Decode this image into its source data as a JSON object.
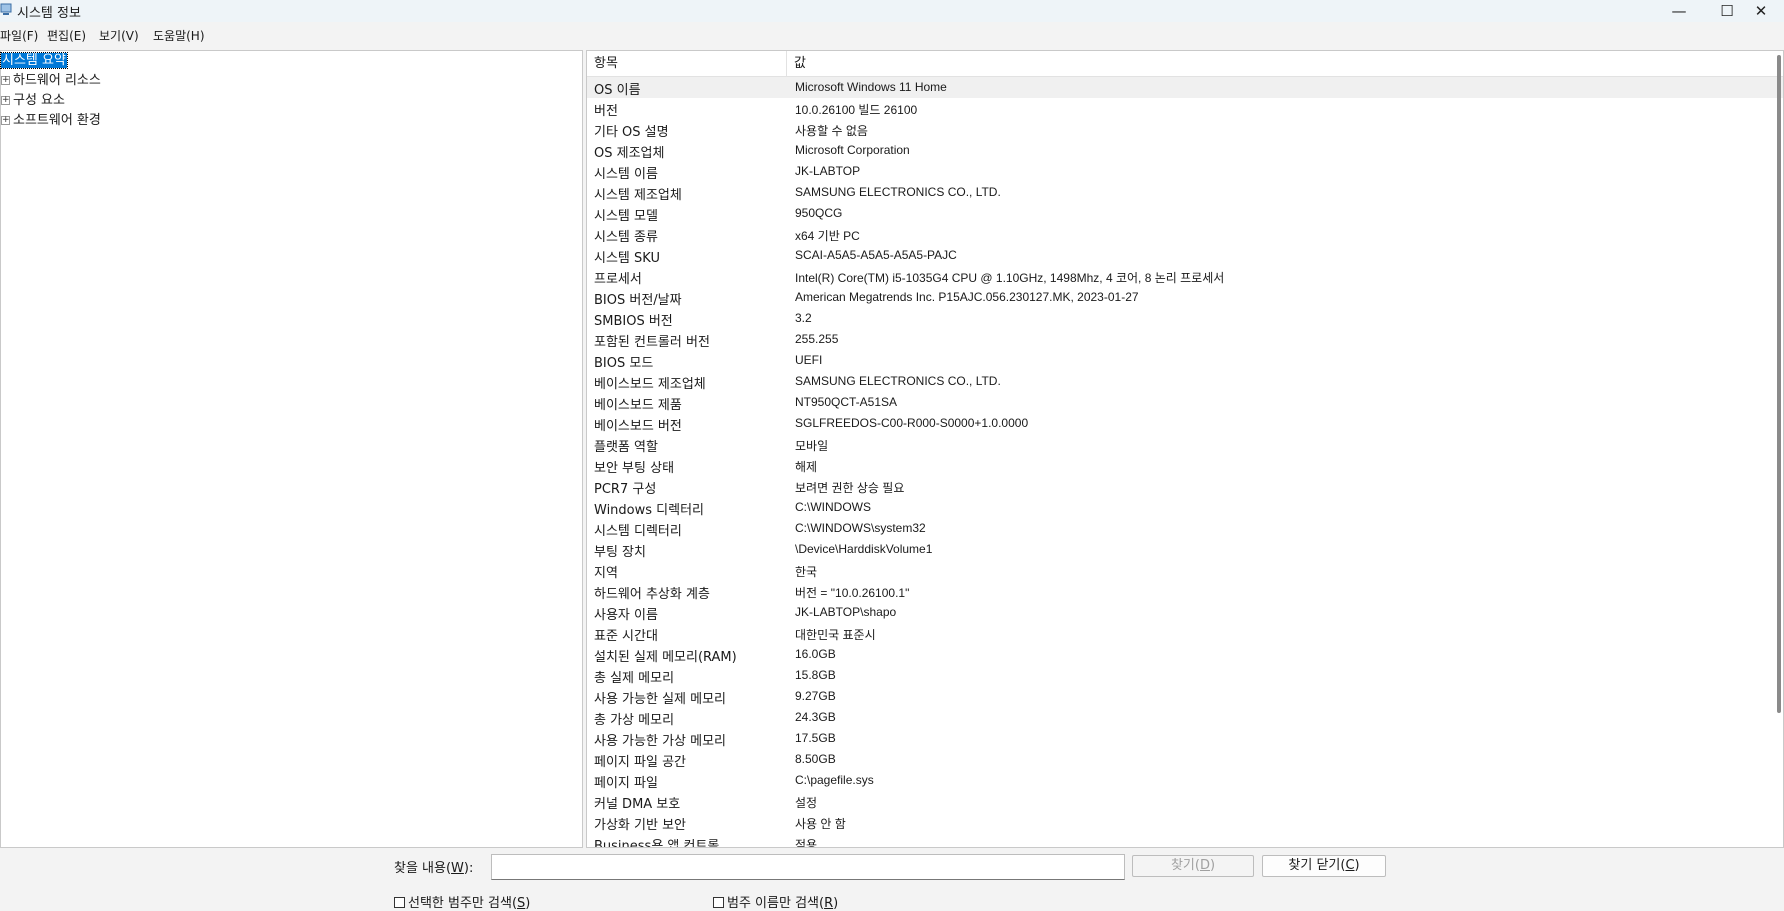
{
  "window": {
    "title": "시스템 정보",
    "controls": {
      "minimize": "—",
      "maximize": "☐",
      "close": "✕"
    }
  },
  "menu": {
    "items": [
      "파일(F)",
      "편집(E)",
      "보기(V)",
      "도움말(H)"
    ]
  },
  "tree": {
    "items": [
      {
        "label": "시스템 요약",
        "selected": true,
        "expander": ""
      },
      {
        "label": "하드웨어 리소스",
        "expander": "+"
      },
      {
        "label": "구성 요소",
        "expander": "+"
      },
      {
        "label": "소프트웨어 환경",
        "expander": "+"
      }
    ]
  },
  "details": {
    "headers": {
      "item": "항목",
      "value": "값"
    },
    "rows": [
      {
        "item": "OS 이름",
        "value": "Microsoft Windows 11 Home"
      },
      {
        "item": "버전",
        "value": "10.0.26100 빌드 26100"
      },
      {
        "item": "기타 OS 설명",
        "value": "사용할 수 없음"
      },
      {
        "item": "OS 제조업체",
        "value": "Microsoft Corporation"
      },
      {
        "item": "시스템 이름",
        "value": "JK-LABTOP"
      },
      {
        "item": "시스템 제조업체",
        "value": "SAMSUNG ELECTRONICS CO., LTD."
      },
      {
        "item": "시스템 모델",
        "value": "950QCG"
      },
      {
        "item": "시스템 종류",
        "value": "x64 기반 PC"
      },
      {
        "item": "시스템 SKU",
        "value": "SCAI-A5A5-A5A5-A5A5-PAJC"
      },
      {
        "item": "프로세서",
        "value": "Intel(R) Core(TM) i5-1035G4 CPU @ 1.10GHz, 1498Mhz, 4 코어, 8 논리 프로세서"
      },
      {
        "item": "BIOS 버전/날짜",
        "value": "American Megatrends Inc. P15AJC.056.230127.MK, 2023-01-27"
      },
      {
        "item": "SMBIOS 버전",
        "value": "3.2"
      },
      {
        "item": "포함된 컨트롤러 버전",
        "value": "255.255"
      },
      {
        "item": "BIOS 모드",
        "value": "UEFI"
      },
      {
        "item": "베이스보드 제조업체",
        "value": "SAMSUNG ELECTRONICS CO., LTD."
      },
      {
        "item": "베이스보드 제품",
        "value": "NT950QCT-A51SA"
      },
      {
        "item": "베이스보드 버전",
        "value": "SGLFREEDOS-C00-R000-S0000+1.0.0000"
      },
      {
        "item": "플랫폼 역할",
        "value": "모바일"
      },
      {
        "item": "보안 부팅 상태",
        "value": "해제"
      },
      {
        "item": "PCR7 구성",
        "value": "보려면 권한 상승 필요"
      },
      {
        "item": "Windows 디렉터리",
        "value": "C:\\WINDOWS"
      },
      {
        "item": "시스템 디렉터리",
        "value": "C:\\WINDOWS\\system32"
      },
      {
        "item": "부팅 장치",
        "value": "\\Device\\HarddiskVolume1"
      },
      {
        "item": "지역",
        "value": "한국"
      },
      {
        "item": "하드웨어 추상화 계층",
        "value": "버전 = \"10.0.26100.1\""
      },
      {
        "item": "사용자 이름",
        "value": "JK-LABTOP\\shapo"
      },
      {
        "item": "표준 시간대",
        "value": "대한민국 표준시"
      },
      {
        "item": "설치된 실제 메모리(RAM)",
        "value": "16.0GB"
      },
      {
        "item": "총 실제 메모리",
        "value": "15.8GB"
      },
      {
        "item": "사용 가능한 실제 메모리",
        "value": "9.27GB"
      },
      {
        "item": "총 가상 메모리",
        "value": "24.3GB"
      },
      {
        "item": "사용 가능한 가상 메모리",
        "value": "17.5GB"
      },
      {
        "item": "페이지 파일 공간",
        "value": "8.50GB"
      },
      {
        "item": "페이지 파일",
        "value": "C:\\pagefile.sys"
      },
      {
        "item": "커널 DMA 보호",
        "value": "설정"
      },
      {
        "item": "가상화 기반 보안",
        "value": "사용 안 함"
      },
      {
        "item": "Business용 앱 컨트롤...",
        "value": "적용"
      }
    ]
  },
  "find": {
    "label_pre": "찾을 내용(",
    "label_key": "W",
    "label_post": "):",
    "input_value": "",
    "find_button": {
      "pre": "찾기(",
      "key": "D",
      "post": ")"
    },
    "close_button": {
      "pre": "찾기 닫기(",
      "key": "C",
      "post": ")"
    },
    "check_selected": {
      "pre": "선택한 범주만 검색(",
      "key": "S",
      "post": ")"
    },
    "check_names": {
      "pre": "범주 이름만 검색(",
      "key": "R",
      "post": ")"
    }
  }
}
